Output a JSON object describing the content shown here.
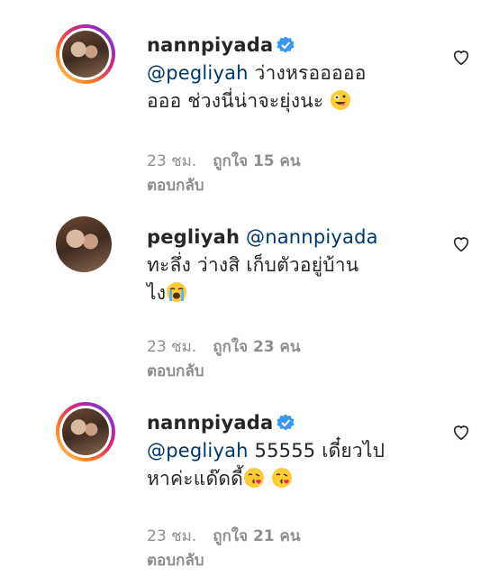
{
  "comments": [
    {
      "username": "nannpiyada",
      "verified": true,
      "mention": "@pegliyah",
      "line1": " ว่างหรอออออ",
      "line2": "อออ ช่วงนี่น่าจะยุ่งนะ",
      "emojis_line2": [
        "zany-face"
      ],
      "time": "23 ชม.",
      "likes": "ถูกใจ 15 คน",
      "reply": "ตอบกลับ"
    },
    {
      "username": "pegliyah",
      "verified": false,
      "mention": "@nannpiyada",
      "line1": "ทะลึ่ง ว่างสิ เก็บตัวอยู่บ้าน",
      "line2": "ไง",
      "emojis_line2": [
        "loudly-crying-face"
      ],
      "time": "23 ชม.",
      "likes": "ถูกใจ 23 คน",
      "reply": "ตอบกลับ"
    },
    {
      "username": "nannpiyada",
      "verified": true,
      "mention": "@pegliyah",
      "line1": " 55555 เดี๋ยวไป",
      "line2": "หาค่ะแด๊ดดี้",
      "emojis_line2": [
        "face-blowing-kiss",
        "face-blowing-kiss"
      ],
      "time": "23 ชม.",
      "likes": "ถูกใจ 21 คน",
      "reply": "ตอบกลับ"
    }
  ],
  "colors": {
    "mention": "#00376b",
    "meta": "#8e8e8e",
    "verified": "#3897f0"
  }
}
